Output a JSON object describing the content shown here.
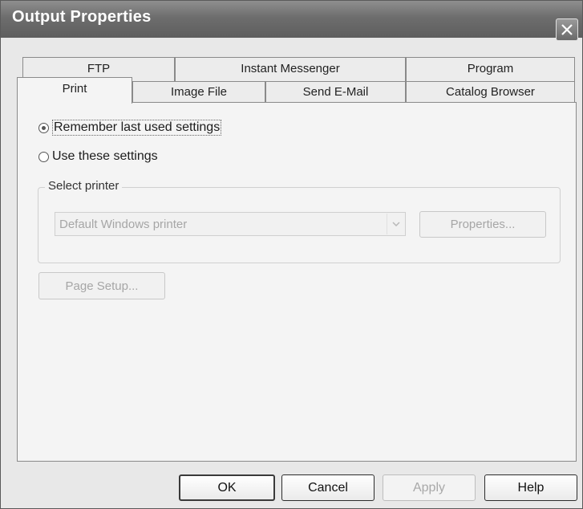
{
  "window": {
    "title": "Output Properties"
  },
  "tabs": {
    "row_back": [
      {
        "label": "FTP"
      },
      {
        "label": "Instant Messenger"
      },
      {
        "label": "Program"
      }
    ],
    "row_front": [
      {
        "label": "Print",
        "active": true
      },
      {
        "label": "Image File"
      },
      {
        "label": "Send E-Mail"
      },
      {
        "label": "Catalog Browser"
      }
    ]
  },
  "options": {
    "remember_label": "Remember last used settings",
    "use_these_label": "Use these settings",
    "selected": "remember"
  },
  "printer_group": {
    "legend": "Select printer",
    "printer_value": "Default Windows printer",
    "properties_button": "Properties..."
  },
  "page_setup_button": "Page Setup...",
  "footer": {
    "ok": "OK",
    "cancel": "Cancel",
    "apply": "Apply",
    "help": "Help"
  }
}
